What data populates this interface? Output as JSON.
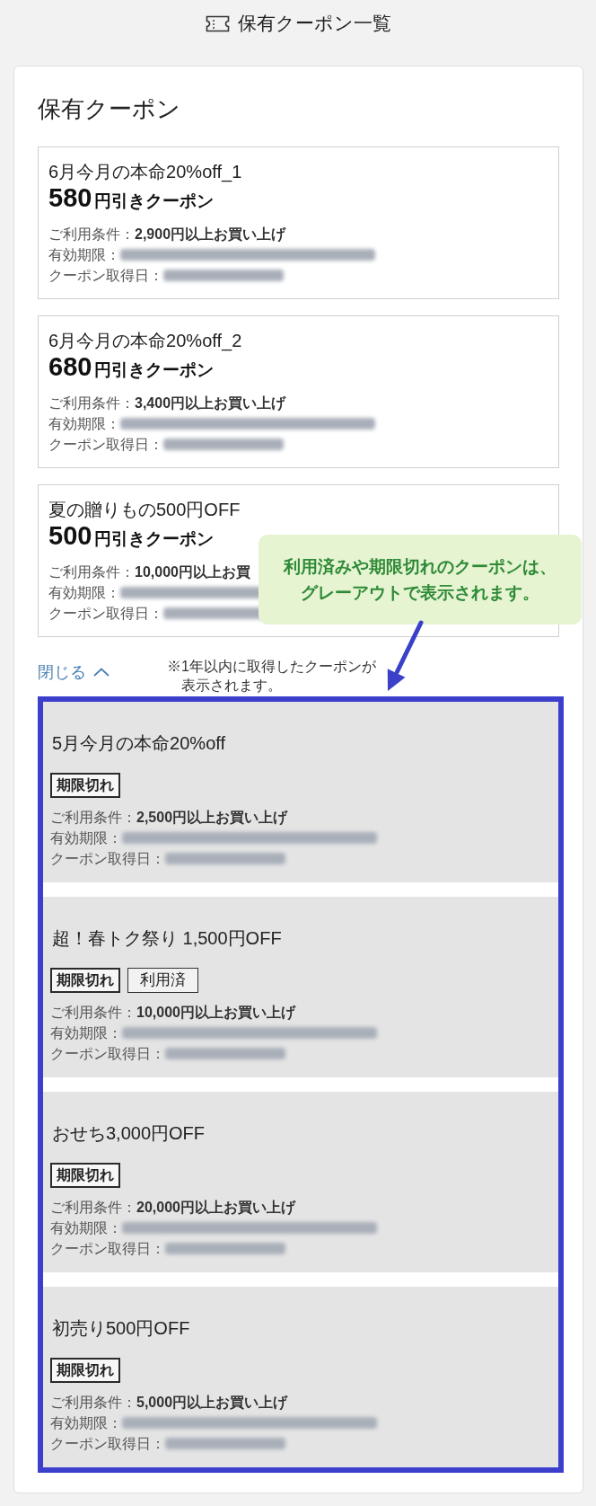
{
  "header": {
    "title": "保有クーポン一覧"
  },
  "section": {
    "title": "保有クーポン"
  },
  "coupons": [
    {
      "name": "6月今月の本命20%off_1",
      "amount": "580",
      "amount_unit": "円引きクーポン",
      "condition": "ご利用条件：**2,900円以上お買い上げ**",
      "period_label": "有効期限：",
      "acquired_label": "クーポン取得日："
    },
    {
      "name": "6月今月の本命20%off_2",
      "amount": "680",
      "amount_unit": "円引きクーポン",
      "condition": "ご利用条件：**3,400円以上お買い上げ**",
      "period_label": "有効期限：",
      "acquired_label": "クーポン取得日："
    },
    {
      "name": "夏の贈りもの500円OFF",
      "amount": "500",
      "amount_unit": "円引きクーポン",
      "condition": "ご利用条件：**10,000円以上お買**",
      "period_label": "有効期限：",
      "acquired_label": "クーポン取得日："
    }
  ],
  "callout": {
    "lines": [
      "利用済みや期限切れのクーポンは、",
      "グレーアウトで表示されます。"
    ]
  },
  "toggle": {
    "label": "閉じる",
    "expanded": true
  },
  "note": {
    "lines": [
      "※1年以内に取得したクーポンが",
      "表示されます。"
    ]
  },
  "past_coupons": [
    {
      "name": "5月今月の本命20%off",
      "badges": [
        {
          "label": "期限切れ",
          "kind": "expired"
        }
      ],
      "condition": "ご利用条件：**2,500円以上お買い上げ**",
      "period_label": "有効期限：",
      "acquired_label": "クーポン取得日："
    },
    {
      "name": "超！春トク祭り 1,500円OFF",
      "badges": [
        {
          "label": "期限切れ",
          "kind": "expired"
        },
        {
          "label": "利用済",
          "kind": "used"
        }
      ],
      "condition": "ご利用条件：**10,000円以上お買い上げ**",
      "period_label": "有効期限：",
      "acquired_label": "クーポン取得日："
    },
    {
      "name": "おせち3,000円OFF",
      "badges": [
        {
          "label": "期限切れ",
          "kind": "expired"
        }
      ],
      "condition": "ご利用条件：**20,000円以上お買い上げ**",
      "period_label": "有効期限：",
      "acquired_label": "クーポン取得日："
    },
    {
      "name": "初売り500円OFF",
      "badges": [
        {
          "label": "期限切れ",
          "kind": "expired"
        }
      ],
      "condition": "ご利用条件：**5,000円以上お買い上げ**",
      "period_label": "有効期限：",
      "acquired_label": "クーポン取得日："
    }
  ]
}
